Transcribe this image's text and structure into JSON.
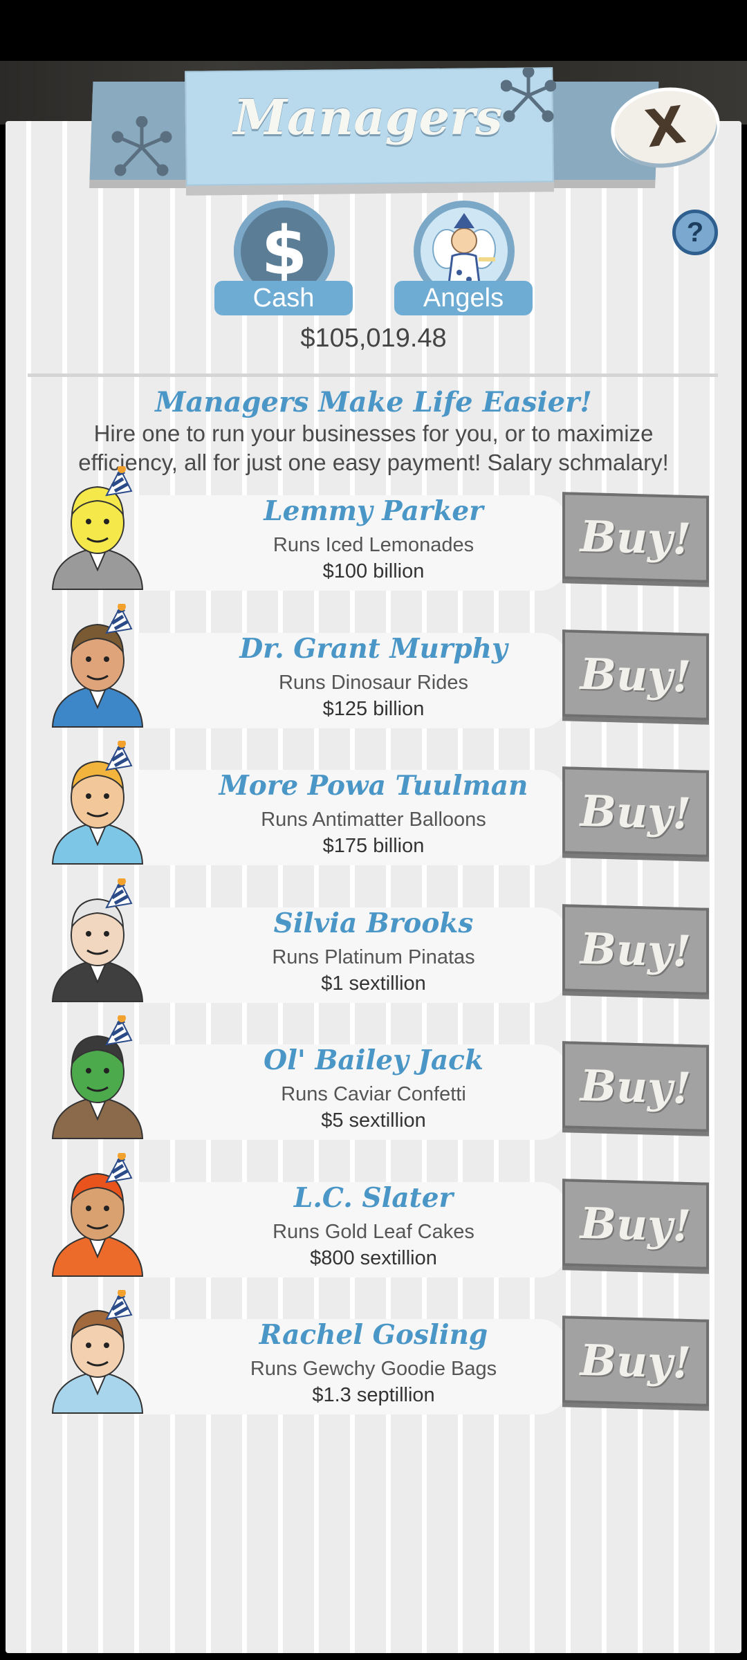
{
  "header": {
    "title": "Managers",
    "close_label": "X",
    "help_label": "?"
  },
  "currencies": [
    {
      "label": "Cash",
      "icon": "dollar-icon"
    },
    {
      "label": "Angels",
      "icon": "angel-icon"
    }
  ],
  "cash_amount": "$105,019.48",
  "intro": {
    "title": "Managers Make Life Easier!",
    "text": "Hire one to run your businesses for you, or to maximize efficiency, all for just one easy payment! Salary schmalary!"
  },
  "buy_label": "Buy!",
  "managers": [
    {
      "name": "Lemmy Parker",
      "runs": "Runs Iced Lemonades",
      "price": "$100 billion",
      "face": "#f4e84a",
      "shirt": "#9a9a9a",
      "hair": "#f4e84a"
    },
    {
      "name": "Dr. Grant Murphy",
      "runs": "Runs Dinosaur Rides",
      "price": "$125 billion",
      "face": "#e0a47a",
      "shirt": "#3d86c8",
      "hair": "#7a5a32"
    },
    {
      "name": "More Powa Tuulman",
      "runs": "Runs Antimatter Balloons",
      "price": "$175 billion",
      "face": "#f2c79a",
      "shirt": "#7ec6e6",
      "hair": "#f2b43c"
    },
    {
      "name": "Silvia Brooks",
      "runs": "Runs Platinum Pinatas",
      "price": "$1 sextillion",
      "face": "#f2d7c0",
      "shirt": "#3f3f3f",
      "hair": "#e6e6e6"
    },
    {
      "name": "Ol' Bailey Jack",
      "runs": "Runs Caviar Confetti",
      "price": "$5 sextillion",
      "face": "#4caa4c",
      "shirt": "#8a6a4a",
      "hair": "#3a3a3a"
    },
    {
      "name": "L.C. Slater",
      "runs": "Runs Gold Leaf Cakes",
      "price": "$800 sextillion",
      "face": "#d9a070",
      "shirt": "#ec6a2a",
      "hair": "#e8541c"
    },
    {
      "name": "Rachel Gosling",
      "runs": "Runs Gewchy Goodie Bags",
      "price": "$1.3 septillion",
      "face": "#f2d0b0",
      "shirt": "#a8d4ec",
      "hair": "#a26a3c"
    }
  ]
}
